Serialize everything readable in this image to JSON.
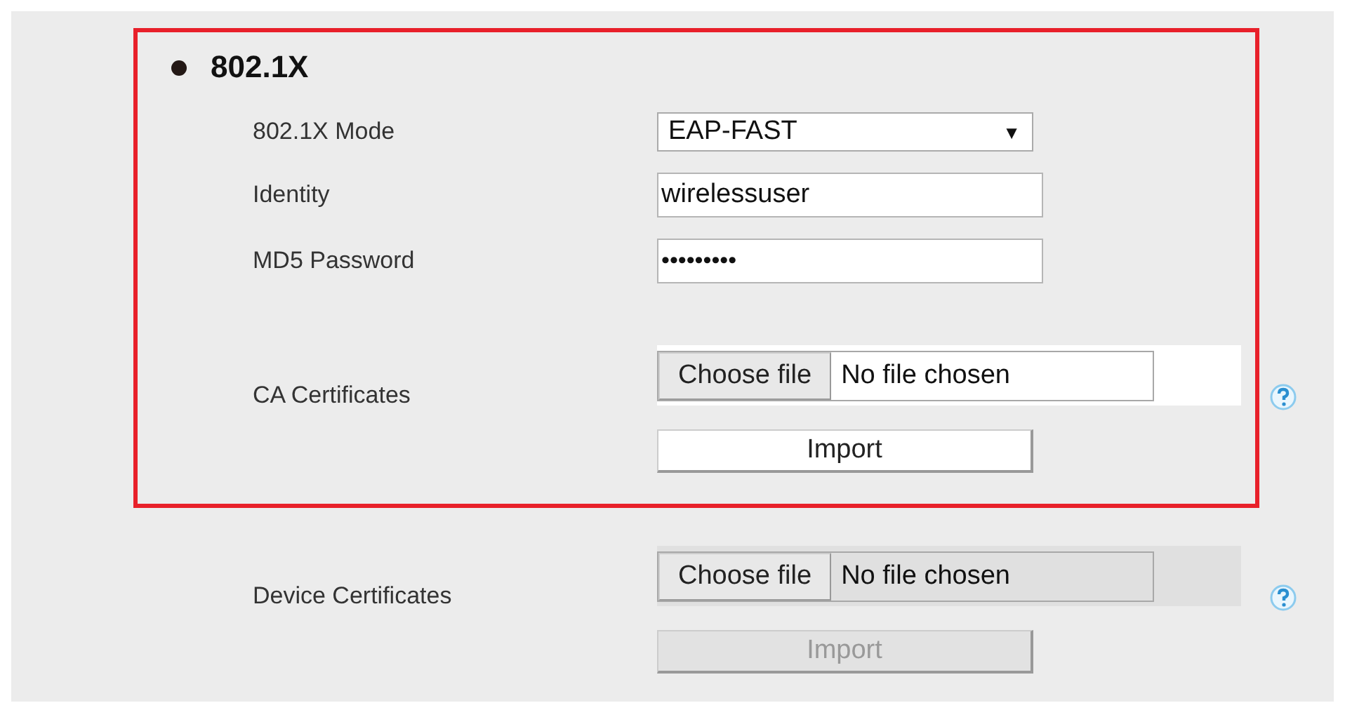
{
  "section": {
    "title": "802.1X",
    "fields": [
      {
        "kind": "select",
        "label": "802.1X Mode",
        "value": "EAP-FAST",
        "caret": "▼"
      },
      {
        "kind": "text",
        "label": "Identity",
        "value": "wirelessuser"
      },
      {
        "kind": "password",
        "label": "MD5 Password",
        "value": "•••••••••"
      }
    ],
    "certificates": [
      {
        "label": "CA Certificates",
        "choose": "Choose file",
        "status": "No file chosen",
        "import": "Import",
        "disabled": false
      }
    ]
  },
  "certificates": [
    {
      "label": "Device Certificates",
      "choose": "Choose file",
      "status": "No file chosen",
      "import": "Import",
      "disabled": true
    }
  ]
}
